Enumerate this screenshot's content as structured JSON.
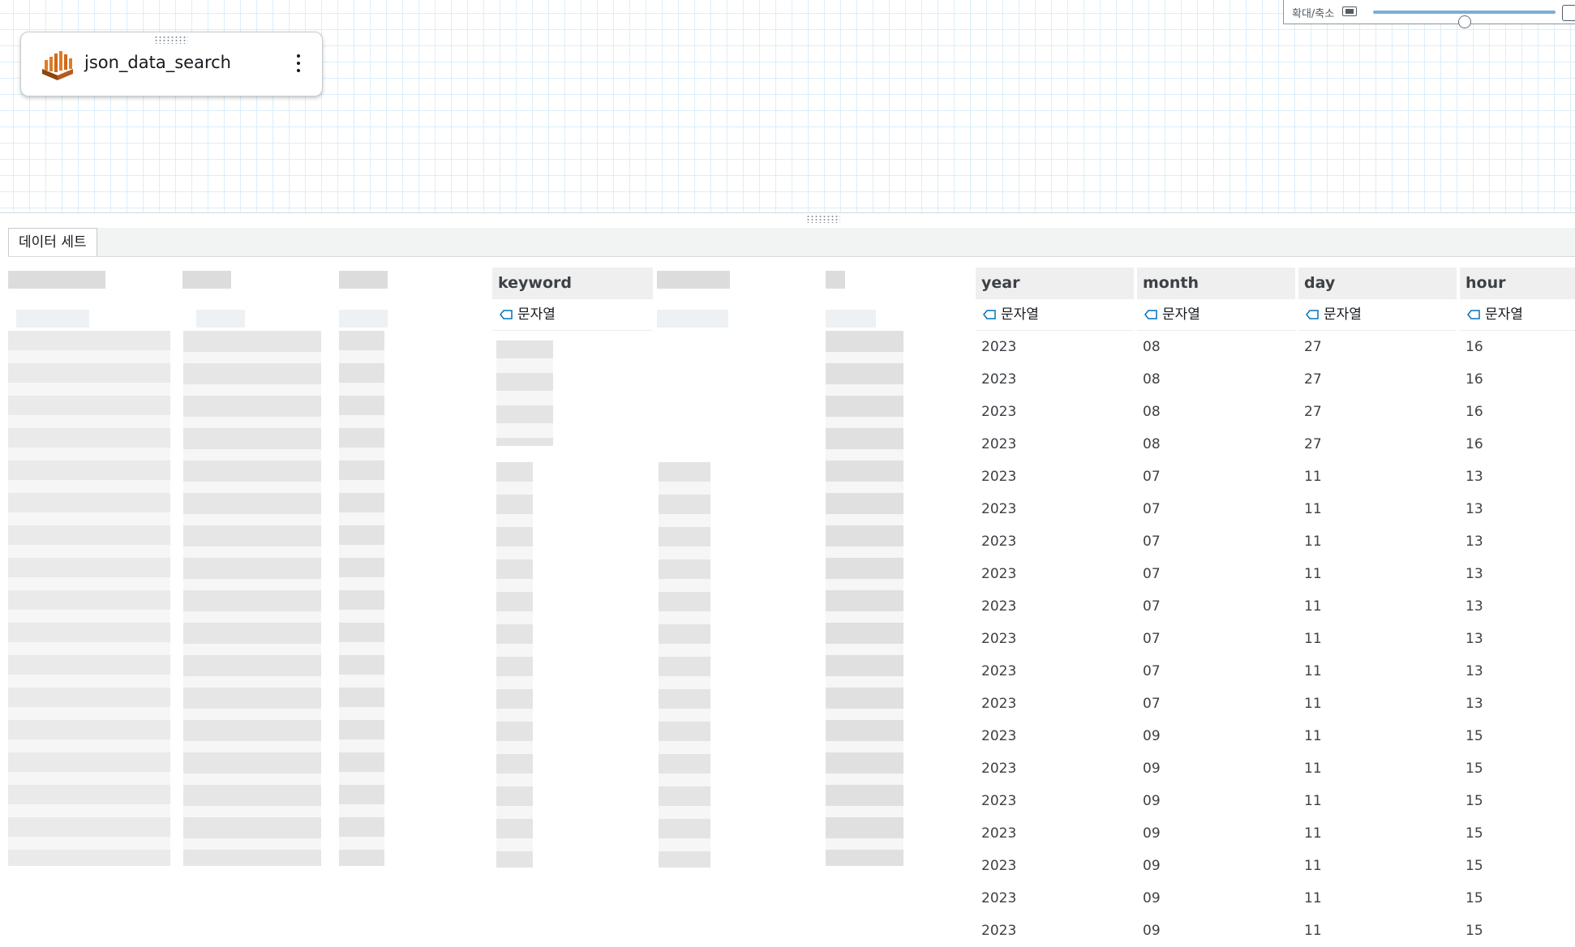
{
  "zoom": {
    "label": "확대/축소",
    "level": 0.5
  },
  "node": {
    "title": "json_data_search",
    "icon": "aws-glue-icon"
  },
  "tabs": [
    {
      "label": "데이터 세트"
    }
  ],
  "columns": [
    {
      "name": "keyword",
      "type": "문자열"
    },
    {
      "name": "year",
      "type": "문자열"
    },
    {
      "name": "month",
      "type": "문자열"
    },
    {
      "name": "day",
      "type": "문자열"
    },
    {
      "name": "hour",
      "type": "문자열"
    }
  ],
  "rows": [
    [
      "2023",
      "08",
      "27",
      "16"
    ],
    [
      "2023",
      "08",
      "27",
      "16"
    ],
    [
      "2023",
      "08",
      "27",
      "16"
    ],
    [
      "2023",
      "08",
      "27",
      "16"
    ],
    [
      "2023",
      "07",
      "11",
      "13"
    ],
    [
      "2023",
      "07",
      "11",
      "13"
    ],
    [
      "2023",
      "07",
      "11",
      "13"
    ],
    [
      "2023",
      "07",
      "11",
      "13"
    ],
    [
      "2023",
      "07",
      "11",
      "13"
    ],
    [
      "2023",
      "07",
      "11",
      "13"
    ],
    [
      "2023",
      "07",
      "11",
      "13"
    ],
    [
      "2023",
      "07",
      "11",
      "13"
    ],
    [
      "2023",
      "09",
      "11",
      "15"
    ],
    [
      "2023",
      "09",
      "11",
      "15"
    ],
    [
      "2023",
      "09",
      "11",
      "15"
    ],
    [
      "2023",
      "09",
      "11",
      "15"
    ],
    [
      "2023",
      "09",
      "11",
      "15"
    ],
    [
      "2023",
      "09",
      "11",
      "15"
    ],
    [
      "2023",
      "09",
      "11",
      "15"
    ]
  ]
}
